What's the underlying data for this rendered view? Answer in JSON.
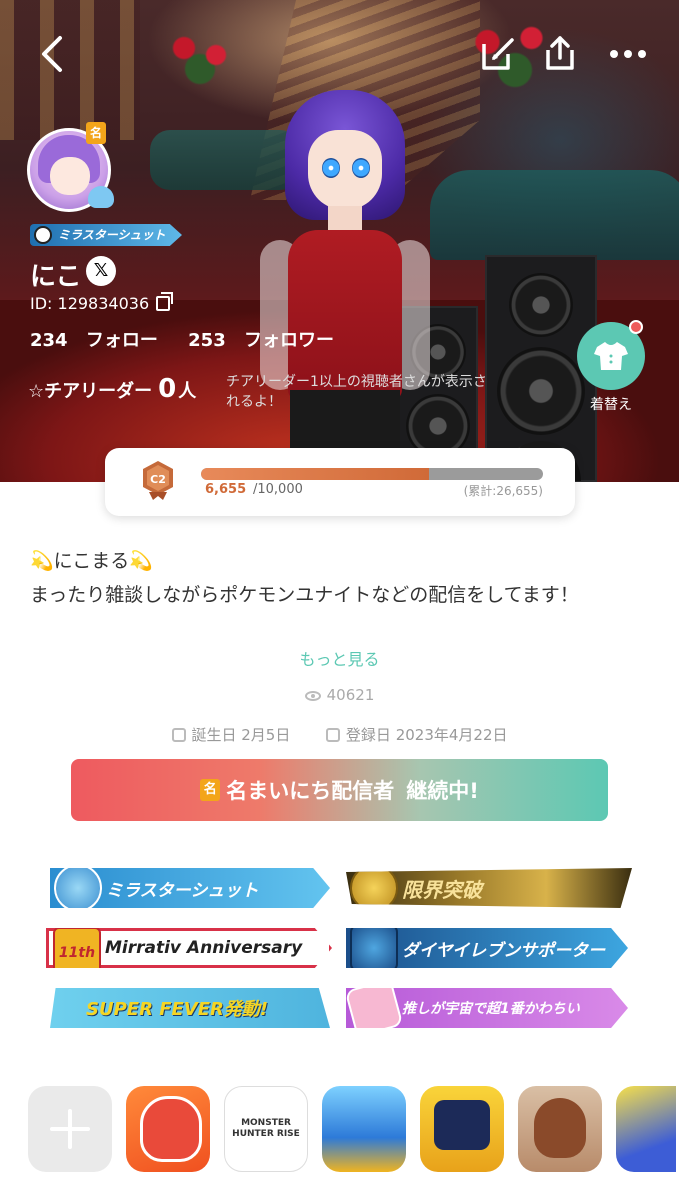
{
  "nav": {
    "back_icon": "chevron-left-icon",
    "edit_icon": "edit-icon",
    "share_icon": "share-icon",
    "more_icon": "more-horizontal-icon"
  },
  "profile": {
    "avatar_mark": "名",
    "badge_label": "ミラスターシュット",
    "name": "にこ",
    "x_label": "𝕏",
    "id_text": "ID: 129834036",
    "following_count": "234",
    "following_label": "フォロー",
    "follower_count": "253",
    "follower_label": "フォロワー",
    "cheer_label": "☆チアリーダー",
    "cheer_count": "0",
    "cheer_unit": "人",
    "cheer_hint": "チアリーダー1以上の視聴者さんが表示されるよ！",
    "dress_label": "着替え"
  },
  "level": {
    "badge_text": "C2",
    "current": "6,655",
    "max": "/10,000",
    "total": "(累計:26,655)",
    "progress": 0.6655
  },
  "bio": {
    "title": "💫にこまる💫",
    "text": "まったり雑談しながらポケモンユナイトなどの配信をしてます！",
    "more_label": "もっと見る"
  },
  "stats": {
    "views": "40621",
    "birthday": "誕生日 2月5日",
    "registered": "登録日 2023年4月22日"
  },
  "streak": {
    "mark": "名",
    "label": "名まいにち配信者",
    "status": "継続中!"
  },
  "badges": [
    {
      "label": "ミラスターシュット"
    },
    {
      "label": "限界突破"
    },
    {
      "label": "Mirrativ Anniversary",
      "emblem": "11th"
    },
    {
      "label": "ダイヤイレブンサポーター"
    },
    {
      "label": "SUPER FEVER発動!"
    },
    {
      "label": "推しが宇宙で超1番かわちい"
    }
  ],
  "games": [
    {
      "name": "add-game"
    },
    {
      "name": "yokai-watch"
    },
    {
      "name": "monster-hunter-rise",
      "label": "MONSTER HUNTER RISE"
    },
    {
      "name": "emo-mon"
    },
    {
      "name": "suraco"
    },
    {
      "name": "anime-girl-game"
    },
    {
      "name": "pokemon-unite"
    }
  ],
  "colors": {
    "accent": "#5cc8b3",
    "streak_start": "#ee5a5f",
    "level_fill": "#d06a38",
    "notification_dot": "#ee5a5a"
  }
}
